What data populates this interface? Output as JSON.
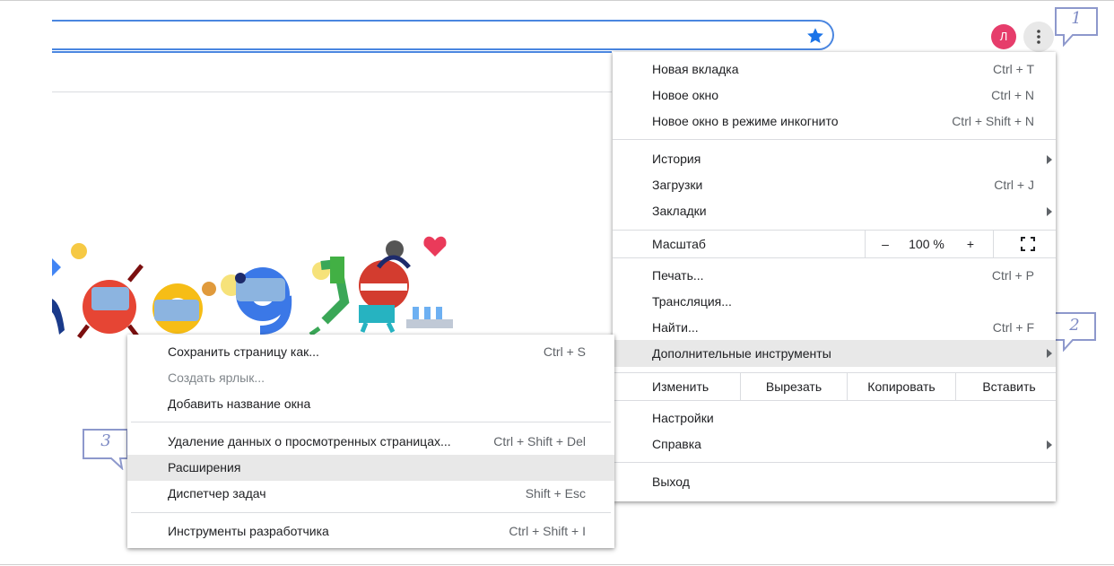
{
  "toolbar": {
    "avatar_letter": "Л"
  },
  "callouts": {
    "one": "1",
    "two": "2",
    "three": "3"
  },
  "menu": {
    "new_tab": {
      "label": "Новая вкладка",
      "shortcut": "Ctrl + T"
    },
    "new_window": {
      "label": "Новое окно",
      "shortcut": "Ctrl + N"
    },
    "incognito": {
      "label": "Новое окно в режиме инкогнито",
      "shortcut": "Ctrl + Shift + N"
    },
    "history": {
      "label": "История"
    },
    "downloads": {
      "label": "Загрузки",
      "shortcut": "Ctrl + J"
    },
    "bookmarks": {
      "label": "Закладки"
    },
    "zoom": {
      "label": "Масштаб",
      "minus": "–",
      "value": "100 %",
      "plus": "+"
    },
    "print": {
      "label": "Печать...",
      "shortcut": "Ctrl + P"
    },
    "cast": {
      "label": "Трансляция..."
    },
    "find": {
      "label": "Найти...",
      "shortcut": "Ctrl + F"
    },
    "more_tools": {
      "label": "Дополнительные инструменты"
    },
    "edit": {
      "label": "Изменить",
      "cut": "Вырезать",
      "copy": "Копировать",
      "paste": "Вставить"
    },
    "settings": {
      "label": "Настройки"
    },
    "help": {
      "label": "Справка"
    },
    "exit": {
      "label": "Выход"
    }
  },
  "submenu": {
    "save_page": {
      "label": "Сохранить страницу как...",
      "shortcut": "Ctrl + S"
    },
    "create_shortcut": {
      "label": "Создать ярлык..."
    },
    "name_window": {
      "label": "Добавить название окна"
    },
    "clear_data": {
      "label": "Удаление данных о просмотренных страницах...",
      "shortcut": "Ctrl + Shift + Del"
    },
    "extensions": {
      "label": "Расширения"
    },
    "task_manager": {
      "label": "Диспетчер задач",
      "shortcut": "Shift + Esc"
    },
    "devtools": {
      "label": "Инструменты разработчика",
      "shortcut": "Ctrl + Shift + I"
    }
  },
  "colors": {
    "accent": "#4a86e0",
    "avatar": "#e63d6b",
    "highlight": "#e8e8e8",
    "callout": "#7d8ac4"
  }
}
